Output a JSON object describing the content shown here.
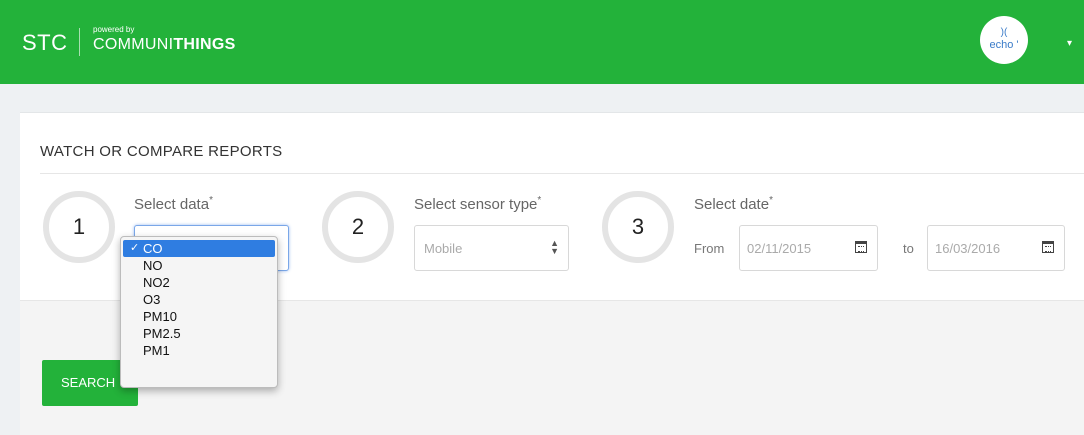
{
  "header": {
    "brand": "STC",
    "powered_by": "powered by",
    "company_part1": "COMMUNI",
    "company_part2": "THINGS",
    "avatar_wave": ")(",
    "avatar_text": "echo '",
    "menu_caret": "▾",
    "color": "#23b23a"
  },
  "panel": {
    "title": "WATCH OR COMPARE REPORTS"
  },
  "steps": [
    {
      "number": "1",
      "label": "Select data",
      "required": "*"
    },
    {
      "number": "2",
      "label": "Select sensor type",
      "required": "*",
      "value": "Mobile"
    },
    {
      "number": "3",
      "label": "Select date",
      "required": "*"
    }
  ],
  "date_range": {
    "from_label": "From",
    "from_value": "02/11/2015",
    "to_label": "to",
    "to_value": "16/03/2016"
  },
  "select_data_dropdown": {
    "selected": "CO",
    "check": "✓",
    "options": [
      "CO",
      "NO",
      "NO2",
      "O3",
      "PM10",
      "PM2.5",
      "PM1"
    ]
  },
  "search_button": {
    "label": "SEARCH"
  },
  "icons": {
    "calendar": "calendar-icon",
    "select_arrows": "updown-arrows-icon"
  }
}
